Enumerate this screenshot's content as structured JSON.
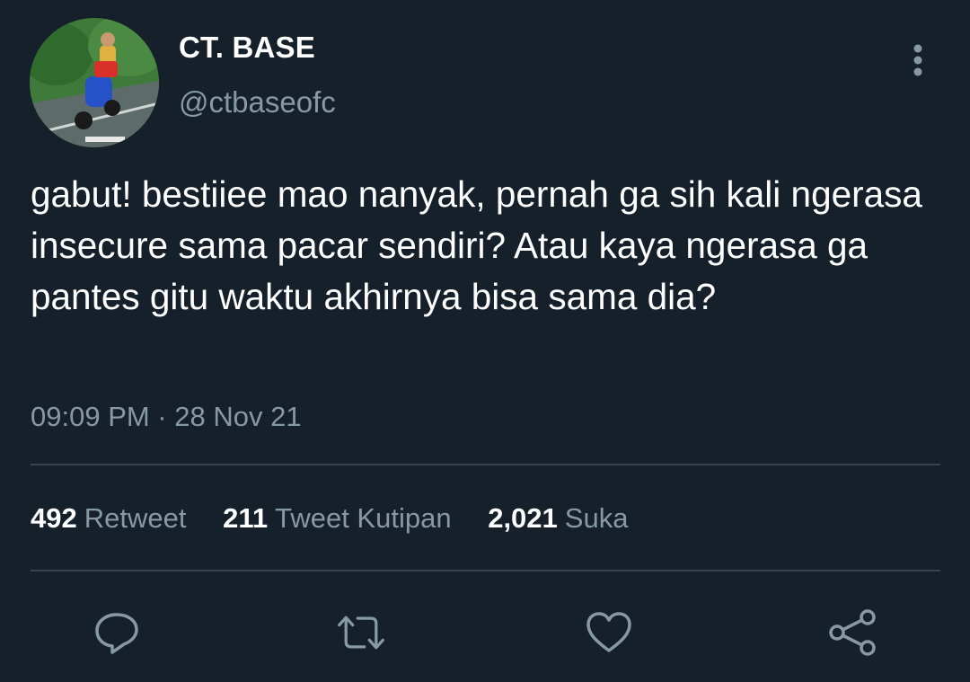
{
  "user": {
    "display_name": "CT. BASE",
    "handle": "@ctbaseofc",
    "avatar_icon": "profile-photo"
  },
  "tweet": {
    "text": "gabut! bestiiee mao nanyak, pernah ga sih kali ngerasa insecure sama pacar sendiri? Atau kaya ngerasa ga pantes gitu waktu akhirnya bisa sama dia?",
    "timestamp": "09:09 PM · 28 Nov 21"
  },
  "stats": {
    "retweets": {
      "count": "492",
      "label": "Retweet"
    },
    "quotes": {
      "count": "211",
      "label": "Tweet Kutipan"
    },
    "likes": {
      "count": "2,021",
      "label": "Suka"
    }
  },
  "actions": [
    {
      "icon": "reply-icon"
    },
    {
      "icon": "retweet-icon"
    },
    {
      "icon": "like-icon"
    },
    {
      "icon": "share-icon"
    }
  ],
  "colors": {
    "background": "#15202b",
    "secondary_text": "#8899a6",
    "divider": "#38444d"
  }
}
